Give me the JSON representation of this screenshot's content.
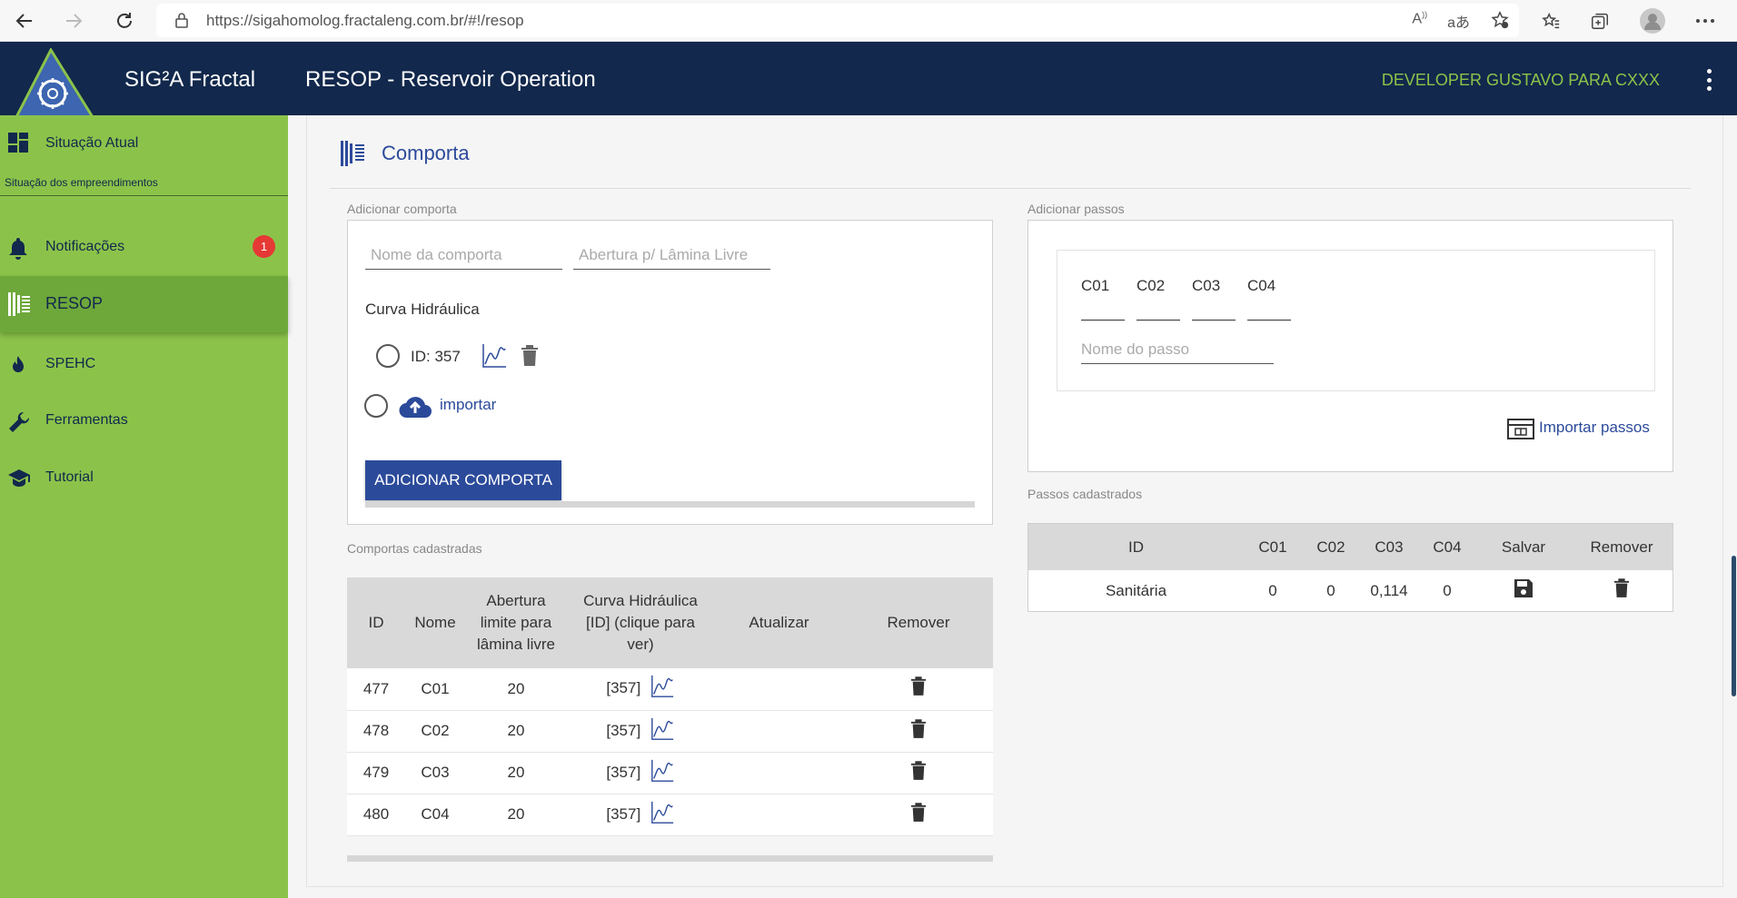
{
  "browser": {
    "url": "https://sigahomolog.fractaleng.com.br/#!/resop"
  },
  "header": {
    "app_name": "SIG²A Fractal",
    "title": "RESOP - Reservoir Operation",
    "user": "DEVELOPER GUSTAVO PARA CXXX"
  },
  "sidebar": {
    "items": [
      {
        "label": "Situação Atual",
        "icon": "dashboard-icon"
      },
      {
        "label": "Notificações",
        "icon": "bell-icon",
        "badge": "1"
      },
      {
        "label": "RESOP",
        "icon": "gate-icon"
      },
      {
        "label": "SPEHC",
        "icon": "fire-icon"
      },
      {
        "label": "Ferramentas",
        "icon": "wrench-icon"
      },
      {
        "label": "Tutorial",
        "icon": "school-icon"
      }
    ],
    "caption": "Situação dos empreendimentos"
  },
  "section": {
    "title": "Comporta"
  },
  "add_gate": {
    "label": "Adicionar comporta",
    "name_placeholder": "Nome da comporta",
    "opening_placeholder": "Abertura p/ Lâmina Livre",
    "curve_title": "Curva Hidráulica",
    "curve_id": "ID: 357",
    "import_label": "importar",
    "button": "ADICIONAR COMPORTA"
  },
  "gates_table": {
    "label": "Comportas cadastradas",
    "headers": [
      "ID",
      "Nome",
      "Abertura limite para lâmina livre",
      "Curva Hidráulica [ID] (clique para ver)",
      "Atualizar",
      "Remover"
    ],
    "rows": [
      {
        "id": "477",
        "name": "C01",
        "opening": "20",
        "curve": "[357]"
      },
      {
        "id": "478",
        "name": "C02",
        "opening": "20",
        "curve": "[357]"
      },
      {
        "id": "479",
        "name": "C03",
        "opening": "20",
        "curve": "[357]"
      },
      {
        "id": "480",
        "name": "C04",
        "opening": "20",
        "curve": "[357]"
      }
    ]
  },
  "add_steps": {
    "label": "Adicionar passos",
    "columns": [
      "C01",
      "C02",
      "C03",
      "C04"
    ],
    "name_placeholder": "Nome do passo",
    "import_label": "Importar passos"
  },
  "steps_table": {
    "label": "Passos cadastrados",
    "headers": [
      "ID",
      "C01",
      "C02",
      "C03",
      "C04",
      "Salvar",
      "Remover"
    ],
    "rows": [
      {
        "id": "Sanitária",
        "c01": "0",
        "c02": "0",
        "c03": "0,114",
        "c04": "0"
      }
    ]
  }
}
